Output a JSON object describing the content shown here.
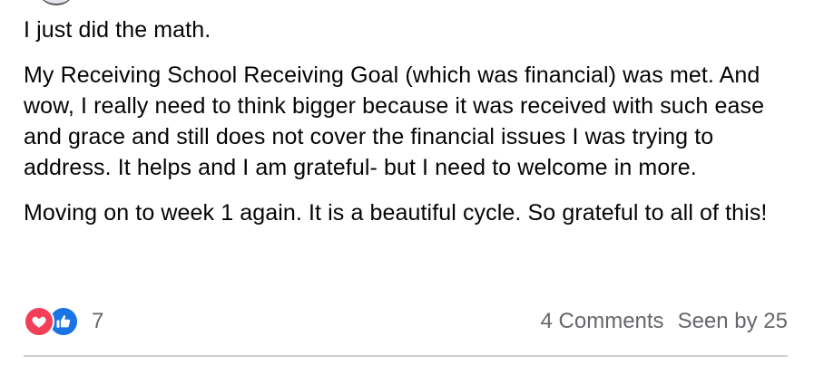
{
  "post": {
    "paragraphs": [
      "I just did the math.",
      "My Receiving School Receiving Goal (which was financial) was met. And wow, I really need to think bigger because it was received with such ease and grace and still does not cover the financial issues I was trying to address. It helps and I am grateful- but I need to welcome in more.",
      "Moving on to week 1 again. It is a beautiful cycle. So grateful to all of this!"
    ]
  },
  "footer": {
    "reactions": {
      "icons": [
        "love-icon",
        "like-icon"
      ],
      "count": "7"
    },
    "comments_label": "4 Comments",
    "seen_label": "Seen by 25"
  },
  "colors": {
    "love": "#f33e58",
    "like": "#1b74e4",
    "secondary_text": "#65676b",
    "divider": "#ced0d4"
  }
}
